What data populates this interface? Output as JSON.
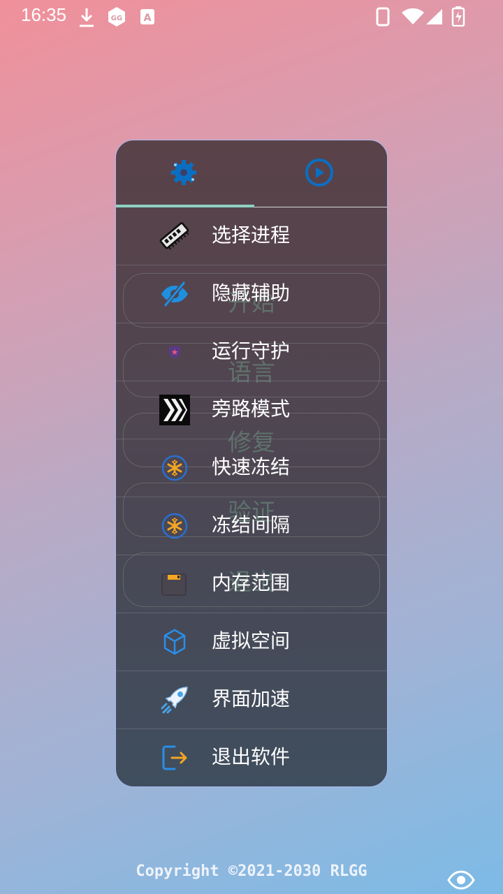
{
  "status_bar": {
    "time": "16:35",
    "icons": [
      "download-icon",
      "gg-icon",
      "a-icon",
      "phone-icon",
      "wifi-icon",
      "signal-icon",
      "battery-icon"
    ]
  },
  "panel": {
    "tabs": [
      {
        "name": "settings",
        "icon": "gear-icon",
        "selected": true
      },
      {
        "name": "play",
        "icon": "play-circle-icon",
        "selected": false
      }
    ],
    "background_buttons": [
      "开始",
      "语言",
      "修复",
      "验证",
      "退出"
    ],
    "menu_items": [
      {
        "label": "选择进程",
        "icon": "memory-chip-icon"
      },
      {
        "label": "隐藏辅助",
        "icon": "eye-off-icon"
      },
      {
        "label": "运行守护",
        "icon": "shield-icon"
      },
      {
        "label": "旁路模式",
        "icon": "bypass-chevrons-icon"
      },
      {
        "label": "快速冻结",
        "icon": "snowflake-icon"
      },
      {
        "label": "冻结间隔",
        "icon": "snowflake-icon"
      },
      {
        "label": "内存范围",
        "icon": "folder-icon"
      },
      {
        "label": "虚拟空间",
        "icon": "cube-icon"
      },
      {
        "label": "界面加速",
        "icon": "rocket-icon"
      },
      {
        "label": "退出软件",
        "icon": "exit-icon"
      }
    ]
  },
  "footer": {
    "copyright": "Copyright ©2021-2030 RLGG",
    "icon": "eye-icon"
  },
  "colors": {
    "accent_blue": "#0a6fc2",
    "tab_indicator": "#8fd1c2",
    "panel_border": "#a9b8ee"
  }
}
